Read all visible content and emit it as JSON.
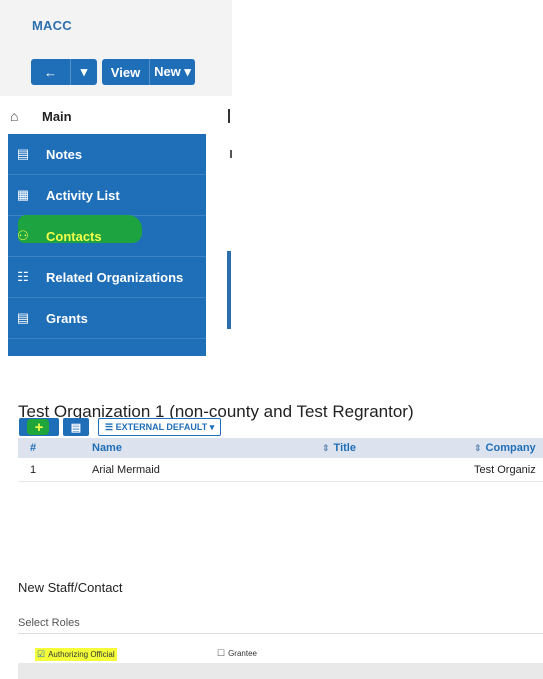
{
  "app": {
    "title": "MACC"
  },
  "toolbar": {
    "back_icon": "arrow-left-icon",
    "caret_icon": "caret-down-icon",
    "view_label": "View",
    "new_label": "New ▾"
  },
  "nav": {
    "main": {
      "label": "Main",
      "icon": "home-icon"
    },
    "items": [
      {
        "label": "Notes",
        "icon": "document-icon",
        "glyph": "🖹"
      },
      {
        "label": "Activity List",
        "icon": "calendar-icon",
        "glyph": "▦"
      },
      {
        "label": "Contacts",
        "icon": "people-icon",
        "glyph": "⚇",
        "highlighted": true
      },
      {
        "label": "Related Organizations",
        "icon": "org-chart-icon",
        "glyph": "☷"
      },
      {
        "label": "Grants",
        "icon": "list-icon",
        "glyph": "▤"
      }
    ]
  },
  "organization": {
    "title": "Test Organization 1 (non-county and Test Regrantor)"
  },
  "grid_toolbar": {
    "add_icon": "plus-icon",
    "export_icon": "grid-icon",
    "view_label": "☰ EXTERNAL DEFAULT ▾"
  },
  "contacts_table": {
    "headers": {
      "num": "#",
      "name": "Name",
      "title": "Title",
      "company": "Company"
    },
    "rows": [
      {
        "num": "1",
        "name": "Arial Mermaid",
        "title": "",
        "company": "Test Organiz"
      }
    ]
  },
  "new_contact": {
    "title": "New Staff/Contact",
    "roles_label": "Select Roles",
    "roles": [
      {
        "label": "Authorizing Official",
        "checked": true
      },
      {
        "label": "Grantee",
        "checked": false
      }
    ]
  },
  "colors": {
    "brand_blue": "#1f6eb8",
    "highlight_green": "#1fa53a",
    "highlight_yellow": "#f2ff4a"
  }
}
